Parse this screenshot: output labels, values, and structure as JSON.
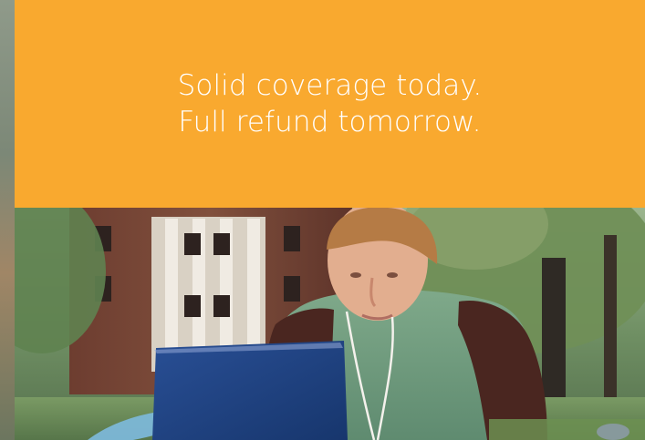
{
  "headline": {
    "line1": "Solid coverage today.",
    "line2": "Full refund tomorrow."
  },
  "photo": {
    "subject": "student-with-laptop-outdoors"
  },
  "colors": {
    "banner": "#f9a92f",
    "headline": "#ffffff",
    "laptop": "#1b3f7e",
    "shirt": "#6f9a7c",
    "sleeve": "#4a2620"
  }
}
